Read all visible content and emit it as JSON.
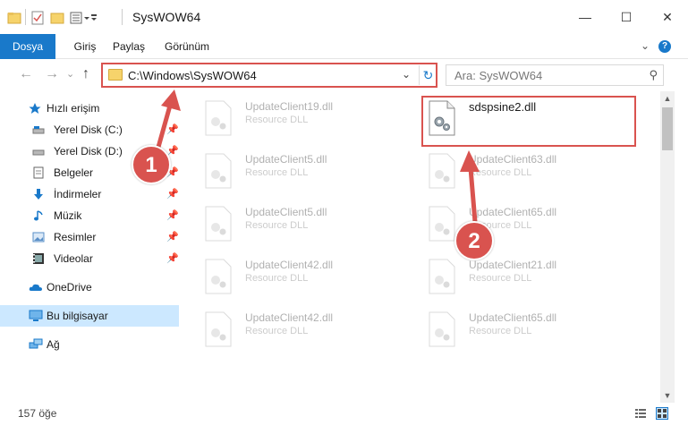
{
  "window": {
    "title": "SysWOW64",
    "minimize": "—",
    "maximize": "☐",
    "close": "✕"
  },
  "ribbon": {
    "tabs": [
      "Dosya",
      "Giriş",
      "Paylaş",
      "Görünüm"
    ],
    "expand": "⌄",
    "help": "?"
  },
  "nav": {
    "back": "←",
    "forward": "→",
    "recent": "⌄",
    "up": "↑",
    "address": "C:\\Windows\\SysWOW64",
    "address_chevron": "⌄",
    "refresh": "↻",
    "search_placeholder": "Ara: SysWOW64",
    "search_icon": "⚲"
  },
  "sidebar": {
    "quick_access": "Hızlı erişim",
    "items": [
      {
        "label": "Yerel Disk (C:)",
        "icon": "drive-icon",
        "pin": "📌"
      },
      {
        "label": "Yerel Disk (D:)",
        "icon": "drive-icon",
        "pin": "📌"
      },
      {
        "label": "Belgeler",
        "icon": "documents-icon",
        "pin": "📌"
      },
      {
        "label": "İndirmeler",
        "icon": "downloads-icon",
        "pin": "📌"
      },
      {
        "label": "Müzik",
        "icon": "music-icon",
        "pin": "📌"
      },
      {
        "label": "Resimler",
        "icon": "pictures-icon",
        "pin": "📌"
      },
      {
        "label": "Videolar",
        "icon": "videos-icon",
        "pin": "📌"
      }
    ],
    "onedrive": "OneDrive",
    "this_pc": "Bu bilgisayar",
    "network": "Ağ"
  },
  "files": {
    "left": [
      {
        "name": "UpdateClient19.dll",
        "type": "Resource DLL"
      },
      {
        "name": "UpdateClient5.dll",
        "type": "Resource DLL"
      },
      {
        "name": "UpdateClient5.dll",
        "type": "Resource DLL"
      },
      {
        "name": "UpdateClient42.dll",
        "type": "Resource DLL"
      },
      {
        "name": "UpdateClient42.dll",
        "type": "Resource DLL"
      }
    ],
    "right": [
      {
        "name": "sdspsine2.dll",
        "type": ""
      },
      {
        "name": "UpdateClient63.dll",
        "type": "Resource DLL"
      },
      {
        "name": "UpdateClient65.dll",
        "type": "Resource DLL"
      },
      {
        "name": "UpdateClient21.dll",
        "type": "Resource DLL"
      },
      {
        "name": "UpdateClient65.dll",
        "type": "Resource DLL"
      }
    ]
  },
  "status": {
    "count": "157 öğe"
  },
  "callouts": [
    "1",
    "2"
  ],
  "colors": {
    "accent": "#1979ca",
    "highlight": "#d9534f",
    "folder": "#f6d36b",
    "selected": "#cce8ff"
  }
}
